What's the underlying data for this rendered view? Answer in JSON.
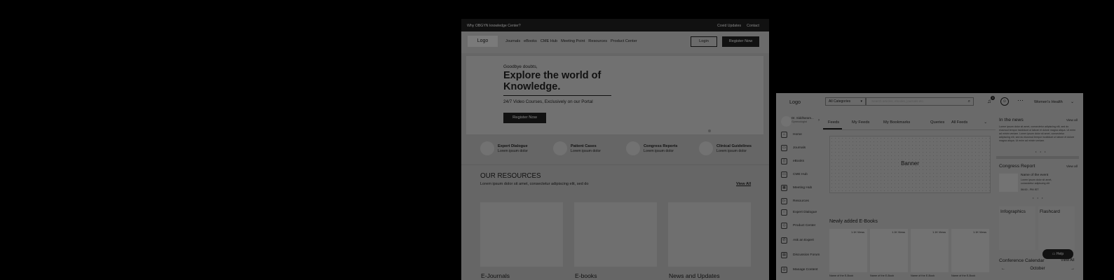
{
  "landing": {
    "topbar": {
      "why": "Why OBGYN knowledge Center?",
      "covid": "Covid Updates",
      "contact": "Contact"
    },
    "logo": "Logo",
    "menu": [
      "Journals",
      "eBooks",
      "CME Hub",
      "Meeting Point",
      "Resources",
      "Product Center"
    ],
    "login": "Login",
    "register": "Register Now",
    "hero": {
      "pre": "Goodbye doubts,",
      "title": "Explore the world of Knowledge.",
      "subtitle": "24/7 Video Courses, Exclusively on our Portal",
      "button": "Register Now"
    },
    "categories": [
      {
        "title": "Expert Dialogue",
        "sub": "Lorem ipsum dolor"
      },
      {
        "title": "Patient Cases",
        "sub": "Lorem ipsum dolor"
      },
      {
        "title": "Congress Reports",
        "sub": "Lorem ipsum dolor"
      },
      {
        "title": "Clinical Guidelines",
        "sub": "Lorem ipsum dolor"
      }
    ],
    "resources": {
      "heading": "OUR RESOURCES",
      "sub": "Lorem ipsum dolor sit amet, consectetur adipiscing elit, sed do",
      "view_all": "View All",
      "cards": [
        "E-Journals",
        "E-books",
        "News and Updates"
      ]
    }
  },
  "dashboard": {
    "logo": "Logo",
    "category_select": "All Categories",
    "search_placeholder": "Search articles, ebooks, journals etc.",
    "notif_count": "3",
    "specialty": "Women's Health",
    "profile": {
      "name": "Dr. Siddharam...",
      "role": "Gynecologist"
    },
    "sidebar": [
      {
        "label": "Home",
        "icon": "home-icon",
        "glyph": "⌂"
      },
      {
        "label": "Journals",
        "icon": "journal-icon",
        "glyph": "▭"
      },
      {
        "label": "eBooks",
        "icon": "ebook-icon",
        "glyph": "▯"
      },
      {
        "label": "CME Hub",
        "icon": "cme-icon",
        "glyph": "▭"
      },
      {
        "label": "Meeting Hub",
        "icon": "calendar-icon",
        "glyph": "▦"
      },
      {
        "label": "Resources",
        "icon": "video-icon",
        "glyph": "▷"
      },
      {
        "label": "Expert Dialogue",
        "icon": "chat-icon",
        "glyph": "◌"
      },
      {
        "label": "Product Center",
        "icon": "box-icon",
        "glyph": "◇"
      },
      {
        "label": "Ask an Expert",
        "icon": "phone-icon",
        "glyph": "✆"
      },
      {
        "label": "Discussion Forum",
        "icon": "forum-icon",
        "glyph": "▤"
      },
      {
        "label": "Manage Content",
        "icon": "people-icon",
        "glyph": "◎"
      }
    ],
    "tabs": [
      "Feeds",
      "My Feeds",
      "My Bookmarks",
      "Queries"
    ],
    "all_feeds": "All Feeds",
    "banner": "Banner",
    "ebooks_heading": "Newly added E-Books",
    "ebooks": [
      {
        "views": "1.1K Views",
        "name": "Name of the E-Book"
      },
      {
        "views": "1.1K Views",
        "name": "Name of the E-Book"
      },
      {
        "views": "1.1K Views",
        "name": "Name of the E-Book"
      },
      {
        "views": "1.1K Views",
        "name": "Name of the E-Book"
      }
    ],
    "news": {
      "heading": "In the news",
      "view_all": "View all",
      "body": "Lorem ipsum dolor sit amet, consectetur adipiscing elit, sed do eiusmod tempor incididunt ut labore et dolore magna aliqua. Ut enim ad minim veniam. Lorem ipsum dolor sit amet, consectetur adipiscing elit, sed do eiusmod tempor incididunt ut labore et dolore magna aliqua. Ut enim ad minim veniam."
    },
    "congress": {
      "heading": "Congress Report",
      "view_all": "View all",
      "title": "Name of the event",
      "desc": "Lorem ipsum dolor sit amet, consectetur adipiscing elit",
      "time": "06:00 - PM IST"
    },
    "infographics": "Infographics",
    "flashcard": "Flashcard",
    "help": "Help",
    "calendar": {
      "heading": "Conference Calendar",
      "view_all": "View All",
      "month": "October"
    }
  }
}
